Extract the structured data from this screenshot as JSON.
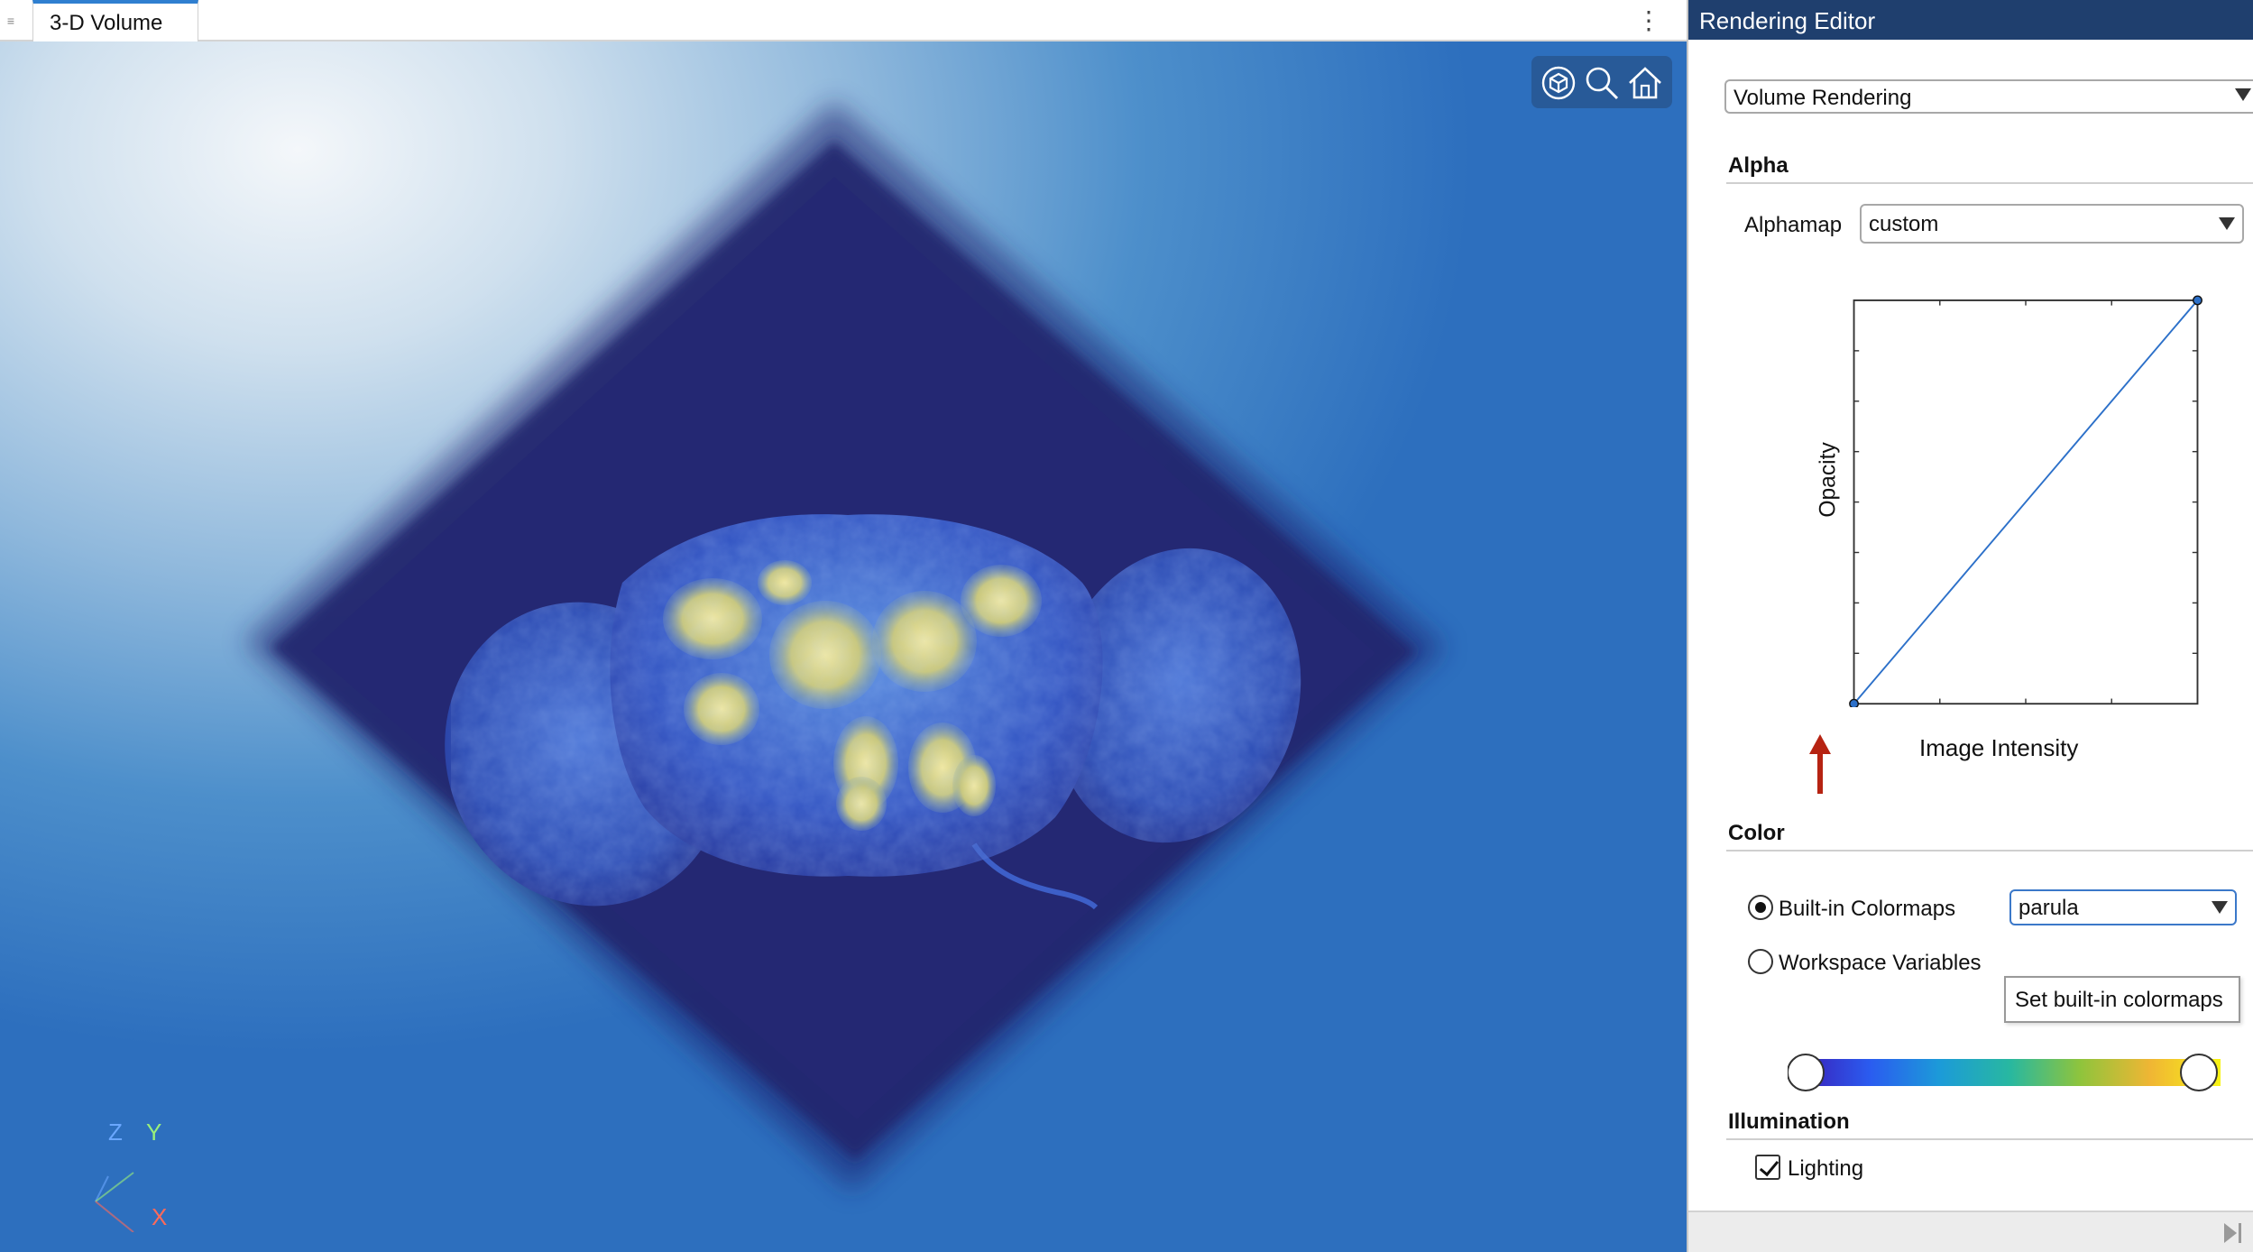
{
  "document": {
    "tab_title": "3-D Volume",
    "grip_icon": "grip-icon",
    "menu_icon": "more-options-icon"
  },
  "viewer": {
    "toolbar_icons": [
      "rotate-3d-icon",
      "zoom-icon",
      "home-icon"
    ],
    "axes": {
      "z": "Z",
      "y": "Y",
      "x": "X"
    },
    "colors": {
      "z": "#6aa7ff",
      "y": "#9af07a",
      "x": "#ff6a5a"
    }
  },
  "editor": {
    "title": "Rendering Editor",
    "render_style": "Volume Rendering",
    "alpha": {
      "section_title": "Alpha",
      "alphamap_label": "Alphamap",
      "alphamap_value": "custom",
      "plot": {
        "ylabel": "Opacity",
        "xlabel": "Image Intensity",
        "control_points": [
          [
            0,
            0
          ],
          [
            1,
            1
          ]
        ]
      }
    },
    "color": {
      "section_title": "Color",
      "builtin_label": "Built-in Colormaps",
      "builtin_selected": true,
      "workspace_label": "Workspace Variables",
      "workspace_selected": false,
      "colormap_value": "parula",
      "tooltip": "Set built-in colormaps",
      "colormap_stops": [
        "#3b1fb8",
        "#2a5cf0",
        "#1c9bd8",
        "#28b8a0",
        "#8fc43c",
        "#f0b634",
        "#f8f415"
      ]
    },
    "illumination": {
      "section_title": "Illumination",
      "lighting_label": "Lighting",
      "lighting_checked": true
    }
  }
}
